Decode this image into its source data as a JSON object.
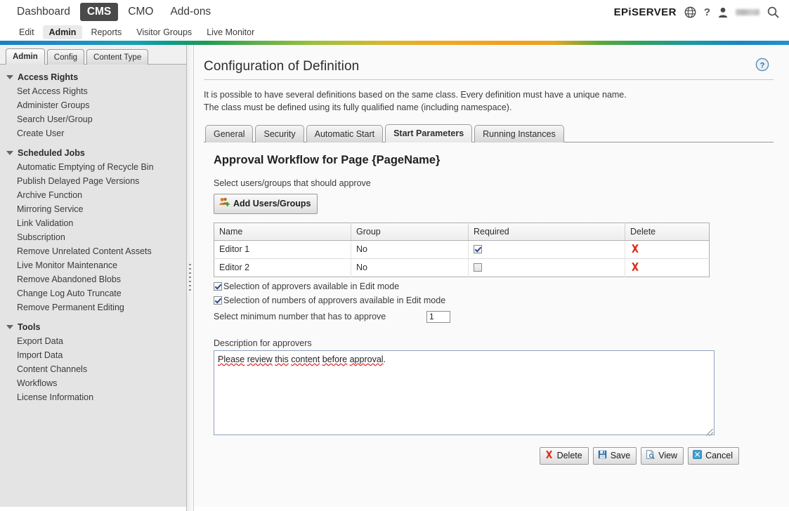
{
  "global_nav": {
    "items": [
      {
        "label": "Dashboard",
        "active": false
      },
      {
        "label": "CMS",
        "active": true
      },
      {
        "label": "CMO",
        "active": false
      },
      {
        "label": "Add-ons",
        "active": false
      }
    ],
    "brand": "EPiSERVER",
    "help_symbol": "?",
    "user_name": ""
  },
  "sub_nav": {
    "items": [
      {
        "label": "Edit",
        "active": false
      },
      {
        "label": "Admin",
        "active": true
      },
      {
        "label": "Reports",
        "active": false
      },
      {
        "label": "Visitor Groups",
        "active": false
      },
      {
        "label": "Live Monitor",
        "active": false
      }
    ]
  },
  "sidebar": {
    "tabs": [
      {
        "label": "Admin",
        "active": true
      },
      {
        "label": "Config",
        "active": false
      },
      {
        "label": "Content Type",
        "active": false
      }
    ],
    "groups": [
      {
        "title": "Access Rights",
        "expanded": true,
        "items": [
          "Set Access Rights",
          "Administer Groups",
          "Search User/Group",
          "Create User"
        ]
      },
      {
        "title": "Scheduled Jobs",
        "expanded": true,
        "items": [
          "Automatic Emptying of Recycle Bin",
          "Publish Delayed Page Versions",
          "Archive Function",
          "Mirroring Service",
          "Link Validation",
          "Subscription",
          "Remove Unrelated Content Assets",
          "Live Monitor Maintenance",
          "Remove Abandoned Blobs",
          "Change Log Auto Truncate",
          "Remove Permanent Editing"
        ]
      },
      {
        "title": "Tools",
        "expanded": true,
        "items": [
          "Export Data",
          "Import Data",
          "Content Channels",
          "Workflows",
          "License Information"
        ]
      }
    ]
  },
  "content": {
    "page_title": "Configuration of Definition",
    "intro_line_1": "It is possible to have several definitions based on the same class. Every definition must have a unique name.",
    "intro_line_2": "The class must be defined using its fully qualified name (including namespace).",
    "tabs": [
      {
        "label": "General",
        "active": false
      },
      {
        "label": "Security",
        "active": false
      },
      {
        "label": "Automatic Start",
        "active": false
      },
      {
        "label": "Start Parameters",
        "active": true
      },
      {
        "label": "Running Instances",
        "active": false
      }
    ],
    "workflow_title": "Approval Workflow for Page {PageName}",
    "select_users_label": "Select users/groups that should approve",
    "add_button_label": "Add Users/Groups",
    "table": {
      "headers": [
        "Name",
        "Group",
        "Required",
        "Delete"
      ],
      "rows": [
        {
          "name": "Editor 1",
          "group": "No",
          "required": true,
          "delete_label": "delete"
        },
        {
          "name": "Editor 2",
          "group": "No",
          "required": false,
          "delete_label": "delete"
        }
      ]
    },
    "options": [
      {
        "label": "Selection of approvers available in Edit mode",
        "checked": true
      },
      {
        "label": "Selection of numbers of approvers available in Edit mode",
        "checked": true
      }
    ],
    "minimum_label": "Select minimum number that has to approve",
    "minimum_value": "1",
    "description_label": "Description for approvers",
    "description_value": "Please review this content before approval.",
    "description_spellchecked_words": [
      "Please",
      "review",
      "this",
      "content",
      "before",
      "approval"
    ],
    "actions": [
      {
        "label": "Delete",
        "icon": "red-x-icon"
      },
      {
        "label": "Save",
        "icon": "floppy-disk-icon"
      },
      {
        "label": "View",
        "icon": "page-preview-icon"
      },
      {
        "label": "Cancel",
        "icon": "blue-x-icon"
      }
    ]
  },
  "colors": {
    "active_nav_bg": "#4a4a4a",
    "rainbow_start": "#1a7fc1",
    "rainbow_mid": "#f2a01e",
    "delete_red": "#e0301e",
    "cancel_blue": "#3f9fd4",
    "link_text": "#3a3a3a"
  }
}
